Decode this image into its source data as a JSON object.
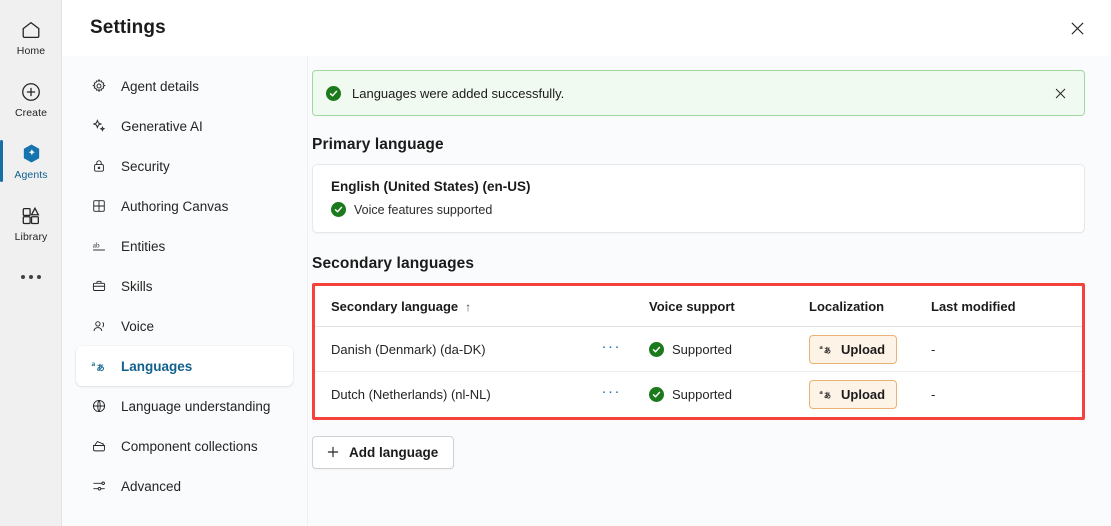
{
  "rail": {
    "items": [
      {
        "label": "Home",
        "icon": "home-icon",
        "selected": false
      },
      {
        "label": "Create",
        "icon": "plus-circle-icon",
        "selected": false
      },
      {
        "label": "Agents",
        "icon": "agents-sparkle-icon",
        "selected": true
      },
      {
        "label": "Library",
        "icon": "library-icon",
        "selected": false
      }
    ],
    "overflow_label": "More"
  },
  "header": {
    "title": "Settings",
    "close_label": "Close"
  },
  "nav": {
    "items": [
      {
        "label": "Agent details",
        "icon": "gear-icon",
        "active": false
      },
      {
        "label": "Generative AI",
        "icon": "sparkle-icon",
        "active": false
      },
      {
        "label": "Security",
        "icon": "lock-icon",
        "active": false
      },
      {
        "label": "Authoring Canvas",
        "icon": "grid-icon",
        "active": false
      },
      {
        "label": "Entities",
        "icon": "ab-icon",
        "active": false
      },
      {
        "label": "Skills",
        "icon": "briefcase-icon",
        "active": false
      },
      {
        "label": "Voice",
        "icon": "voice-icon",
        "active": false
      },
      {
        "label": "Languages",
        "icon": "language-icon",
        "active": true
      },
      {
        "label": "Language understanding",
        "icon": "globe-brain-icon",
        "active": false
      },
      {
        "label": "Component collections",
        "icon": "collections-icon",
        "active": false
      },
      {
        "label": "Advanced",
        "icon": "sliders-icon",
        "active": false
      }
    ]
  },
  "banner": {
    "message": "Languages were added successfully.",
    "icon": "success-check-icon",
    "background": "#f1faf1",
    "border": "#9fd89f",
    "accent": "#1b7a1b"
  },
  "primary": {
    "section_title": "Primary language",
    "language": "English (United States) (en-US)",
    "voice_status": "Voice features supported"
  },
  "secondary": {
    "section_title": "Secondary languages",
    "highlight_color": "#f4433c",
    "columns": [
      {
        "label": "Secondary language",
        "sort": "↑"
      },
      {
        "label": "Voice support"
      },
      {
        "label": "Localization"
      },
      {
        "label": "Last modified"
      }
    ],
    "rows": [
      {
        "language": "Danish (Denmark) (da-DK)",
        "more_label": "···",
        "voice_support": "Supported",
        "localization_button": "Upload",
        "last_modified": "-"
      },
      {
        "language": "Dutch (Netherlands) (nl-NL)",
        "more_label": "···",
        "voice_support": "Supported",
        "localization_button": "Upload",
        "last_modified": "-"
      }
    ],
    "add_button": "Add language",
    "add_icon": "plus-icon"
  }
}
